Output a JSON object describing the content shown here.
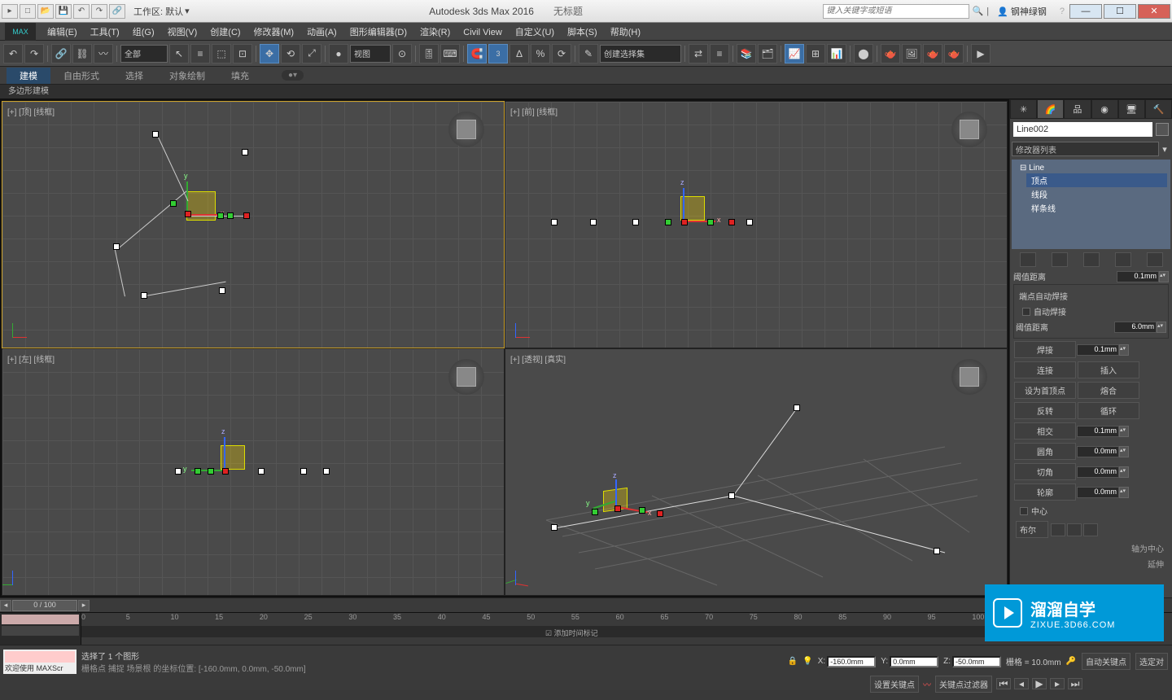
{
  "titlebar": {
    "workspace": "工作区: 默认",
    "app": "Autodesk 3ds Max 2016",
    "doc": "无标题",
    "search_placeholder": "键入关键字或短语",
    "user": "钢神绿钢"
  },
  "menu": [
    "编辑(E)",
    "工具(T)",
    "组(G)",
    "视图(V)",
    "创建(C)",
    "修改器(M)",
    "动画(A)",
    "图形编辑器(D)",
    "渲染(R)",
    "Civil View",
    "自定义(U)",
    "脚本(S)",
    "帮助(H)"
  ],
  "logo": "MAX",
  "toolbar": {
    "filter": "全部",
    "view": "视图",
    "named_selection": "创建选择集"
  },
  "ribbon": {
    "tabs": [
      "建模",
      "自由形式",
      "选择",
      "对象绘制",
      "填充"
    ],
    "sub": "多边形建模"
  },
  "viewports": [
    {
      "label": "[+] [顶] [线框]",
      "active": true
    },
    {
      "label": "[+] [前] [线框]",
      "active": false
    },
    {
      "label": "[+] [左] [线框]",
      "active": false
    },
    {
      "label": "[+] [透视] [真实]",
      "active": false
    }
  ],
  "cmdpanel": {
    "object_name": "Line002",
    "modifier_list": "修改器列表",
    "tree": {
      "root": "Line",
      "items": [
        "顶点",
        "线段",
        "样条线"
      ],
      "selected": "顶点"
    },
    "threshold_label": "阈值距离",
    "threshold1": "0.1mm",
    "end_auto_weld": "端点自动焊接",
    "auto_weld": "自动焊接",
    "threshold2": "6.0mm",
    "rows": [
      {
        "l": "焊接",
        "v": "0.1mm"
      },
      {
        "l": "连接",
        "v": "插入"
      },
      {
        "l": "设为首顶点",
        "v": "熔合"
      },
      {
        "l": "反转",
        "v": "循环"
      },
      {
        "l": "相交",
        "v": "0.1mm"
      },
      {
        "l": "圆角",
        "v": "0.0mm"
      },
      {
        "l": "切角",
        "v": "0.0mm"
      },
      {
        "l": "轮廓",
        "v": "0.0mm"
      }
    ],
    "center": "中心",
    "bool": "布尔",
    "axis_center": "轴为中心",
    "extend": "延伸"
  },
  "timeline": {
    "frame": "0 / 100",
    "ticks": [
      "0",
      "5",
      "10",
      "15",
      "20",
      "25",
      "30",
      "35",
      "40",
      "45",
      "50",
      "55",
      "60",
      "65",
      "70",
      "75",
      "80",
      "85",
      "90",
      "95",
      "100"
    ]
  },
  "status": {
    "welcome": "欢迎使用",
    "script": "MAXScr",
    "sel": "选择了 1 个图形",
    "coord_label": "栅格点 捕捉 场景根 的坐标位置:",
    "coords_display": "[-160.0mm, 0.0mm, -50.0mm]",
    "x": "-160.0mm",
    "y": "0.0mm",
    "z": "-50.0mm",
    "grid": "栅格 = 10.0mm",
    "autokey": "自动关键点",
    "seldir": "选定对",
    "setkey": "设置关键点",
    "keyfilter": "关键点过滤器",
    "addtag": "添加时间标记"
  },
  "watermark": {
    "t1": "溜溜自学",
    "t2": "ZIXUE.3D66.COM"
  }
}
